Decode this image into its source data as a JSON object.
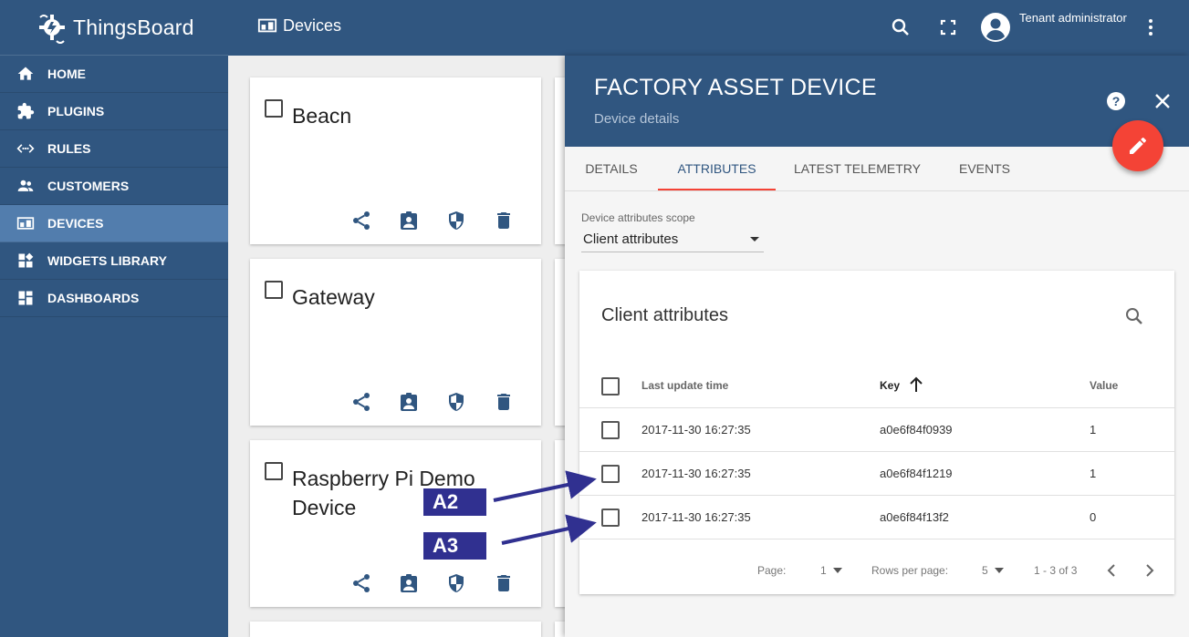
{
  "app": {
    "name": "ThingsBoard"
  },
  "sidebar": {
    "items": [
      {
        "label": "HOME",
        "icon": "home-icon"
      },
      {
        "label": "PLUGINS",
        "icon": "puzzle-icon"
      },
      {
        "label": "RULES",
        "icon": "code-arrows-icon"
      },
      {
        "label": "CUSTOMERS",
        "icon": "people-icon"
      },
      {
        "label": "DEVICES",
        "icon": "devices-icon",
        "active": true
      },
      {
        "label": "WIDGETS LIBRARY",
        "icon": "widgets-icon"
      },
      {
        "label": "DASHBOARDS",
        "icon": "dashboard-icon"
      }
    ]
  },
  "header": {
    "title": "Devices",
    "user": "Tenant administrator"
  },
  "cards": [
    {
      "title": "Beacn"
    },
    {
      "title": "Gateway"
    },
    {
      "title": "Raspberry Pi Demo Device"
    }
  ],
  "panel": {
    "title": "FACTORY ASSET DEVICE",
    "subtitle": "Device details",
    "tabs": [
      "DETAILS",
      "ATTRIBUTES",
      "LATEST TELEMETRY",
      "EVENTS"
    ],
    "active_tab": "ATTRIBUTES",
    "scope_label": "Device attributes scope",
    "scope_value": "Client attributes",
    "table": {
      "title": "Client attributes",
      "headers": {
        "time": "Last update time",
        "key": "Key",
        "value": "Value"
      },
      "rows": [
        {
          "time": "2017-11-30 16:27:35",
          "key": "a0e6f84f0939",
          "value": "1"
        },
        {
          "time": "2017-11-30 16:27:35",
          "key": "a0e6f84f1219",
          "value": "1"
        },
        {
          "time": "2017-11-30 16:27:35",
          "key": "a0e6f84f13f2",
          "value": "0"
        }
      ],
      "pager": {
        "page_label": "Page:",
        "page_value": "1",
        "rows_label": "Rows per page:",
        "rows_value": "5",
        "range": "1 - 3 of 3"
      }
    }
  },
  "annotations": {
    "a2": "A2",
    "a3": "A3"
  },
  "colors": {
    "primary": "#305680",
    "active_nav": "#527dad",
    "accent": "#f44336",
    "annotation": "#303090"
  }
}
